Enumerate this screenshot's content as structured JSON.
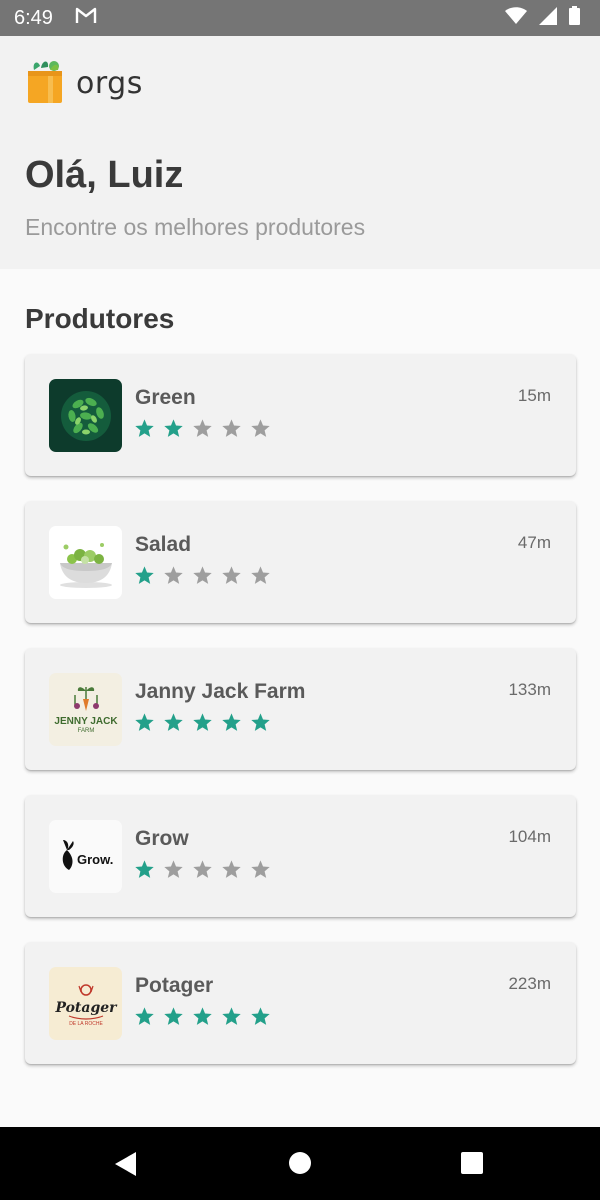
{
  "status_bar": {
    "time": "6:49",
    "notification_icon": "gmail-icon",
    "icons": [
      "wifi-icon",
      "signal-icon",
      "battery-icon"
    ]
  },
  "app": {
    "name": "orgs",
    "logo_icon": "shopping-bag-icon"
  },
  "header": {
    "greeting": "Olá, Luiz",
    "subtitle": "Encontre os melhores produtores"
  },
  "producers_section": {
    "title": "Produtores",
    "max_stars": 5,
    "star_active_color": "#23a08a",
    "star_inactive_color": "#9e9e9e",
    "items": [
      {
        "name": "Green",
        "distance": "15m",
        "rating": 2,
        "thumb": "green-leaves-logo"
      },
      {
        "name": "Salad",
        "distance": "47m",
        "rating": 1,
        "thumb": "salad-bowl-logo"
      },
      {
        "name": "Janny Jack Farm",
        "distance": "133m",
        "rating": 5,
        "thumb": "jenny-jack-farm-logo",
        "thumb_text": "JENNY JACK",
        "thumb_subtext": "FARM"
      },
      {
        "name": "Grow",
        "distance": "104m",
        "rating": 1,
        "thumb": "grow-logo",
        "thumb_text": "Grow."
      },
      {
        "name": "Potager",
        "distance": "223m",
        "rating": 5,
        "thumb": "potager-logo",
        "thumb_text": "Potager",
        "thumb_subtext": "DE LA ROCHE"
      }
    ]
  },
  "nav_bar": {
    "buttons": [
      "back-icon",
      "home-icon",
      "recents-icon"
    ]
  }
}
